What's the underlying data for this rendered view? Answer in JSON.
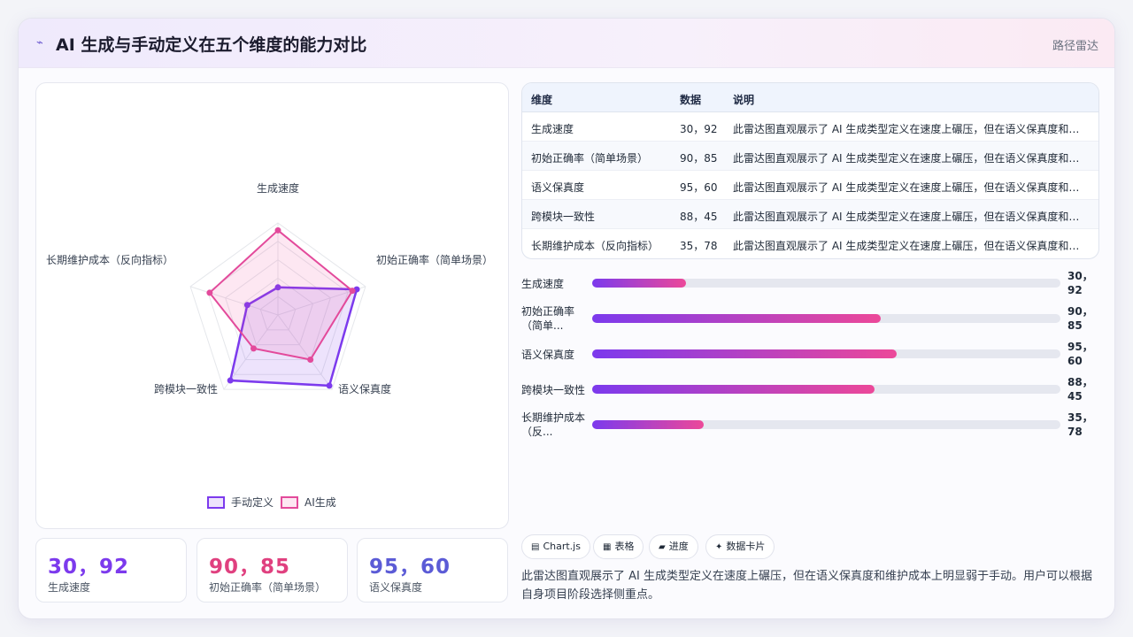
{
  "header": {
    "title": "AI 生成与手动定义在五个维度的能力对比",
    "right_label": "路径雷达",
    "logo_icon": "⌁"
  },
  "chart_data": {
    "type": "radar",
    "axes": [
      "生成速度",
      "初始正确率（简单场景）",
      "语义保真度",
      "跨模块一致性",
      "长期维护成本（反向指标）"
    ],
    "axis_labels_display": [
      "生成速度",
      "初始正确率（简单场景）",
      "语义保真度",
      "跨模块一致性",
      "长期维护成本（反向指标）"
    ],
    "range": [
      0,
      100
    ],
    "grid_levels": 5,
    "series": [
      {
        "name": "手动定义",
        "values": [
          30,
          90,
          95,
          88,
          35
        ],
        "color": "#7c3aed"
      },
      {
        "name": "AI生成",
        "values": [
          92,
          85,
          60,
          45,
          78
        ],
        "color": "#e34a9b"
      }
    ],
    "legend_position": "bottom"
  },
  "stats": [
    {
      "value": "30，92",
      "label": "生成速度",
      "color": "#7c3aed"
    },
    {
      "value": "90，85",
      "label": "初始正确率（简单场景）",
      "color": "#e0407f"
    },
    {
      "value": "95，60",
      "label": "语义保真度",
      "color": "#5b5bd6"
    }
  ],
  "table": {
    "headers": [
      "维度",
      "数据",
      "说明"
    ],
    "rows": [
      [
        "生成速度",
        "30，92",
        "此雷达图直观展示了 AI 生成类型定义在速度上碾压，但在语义保真度和维护成本上明显弱于手动。用户可以根据自身项目阶段选择侧重点。"
      ],
      [
        "初始正确率（简单场景）",
        "90，85",
        "此雷达图直观展示了 AI 生成类型定义在速度上碾压，但在语义保真度和维护成本上明显弱于手动。用户可以根据自身项目阶段选择侧重点。"
      ],
      [
        "语义保真度",
        "95，60",
        "此雷达图直观展示了 AI 生成类型定义在速度上碾压，但在语义保真度和维护成本上明显弱于手动。用户可以根据自身项目阶段选择侧重点。"
      ],
      [
        "跨模块一致性",
        "88，45",
        "此雷达图直观展示了 AI 生成类型定义在速度上碾压，但在语义保真度和维护成本上明显弱于手动。用户可以根据自身项目阶段选择侧重点。"
      ],
      [
        "长期维护成本（反向指标）",
        "35，78",
        "此雷达图直观展示了 AI 生成类型定义在速度上碾压，但在语义保真度和维护成本上明显弱于手动。用户可以根据自身项目阶段选择侧重点。"
      ]
    ]
  },
  "bars": [
    {
      "label_line1": "生成速度",
      "label_line2": "",
      "value_line1": "30，",
      "value_line2": "92",
      "fraction": 0.2
    },
    {
      "label_line1": "初始正确率",
      "label_line2": "（简单...",
      "value_line1": "90，",
      "value_line2": "85",
      "fraction": 0.617
    },
    {
      "label_line1": "语义保真度",
      "label_line2": "",
      "value_line1": "95，",
      "value_line2": "60",
      "fraction": 0.65
    },
    {
      "label_line1": "跨模块一致性",
      "label_line2": "",
      "value_line1": "88，",
      "value_line2": "45",
      "fraction": 0.603
    },
    {
      "label_line1": "长期维护成本",
      "label_line2": "（反...",
      "value_line1": "35，",
      "value_line2": "78",
      "fraction": 0.238
    }
  ],
  "chips": [
    {
      "icon": "▤",
      "label": "Chart.js"
    },
    {
      "icon": "▦",
      "label": "表格"
    },
    {
      "icon": "▰",
      "label": "进度"
    },
    {
      "icon": "✦",
      "label": "数据卡片"
    }
  ],
  "description": "此雷达图直观展示了 AI 生成类型定义在速度上碾压，但在语义保真度和维护成本上明显弱于手动。用户可以根据自身项目阶段选择侧重点。"
}
